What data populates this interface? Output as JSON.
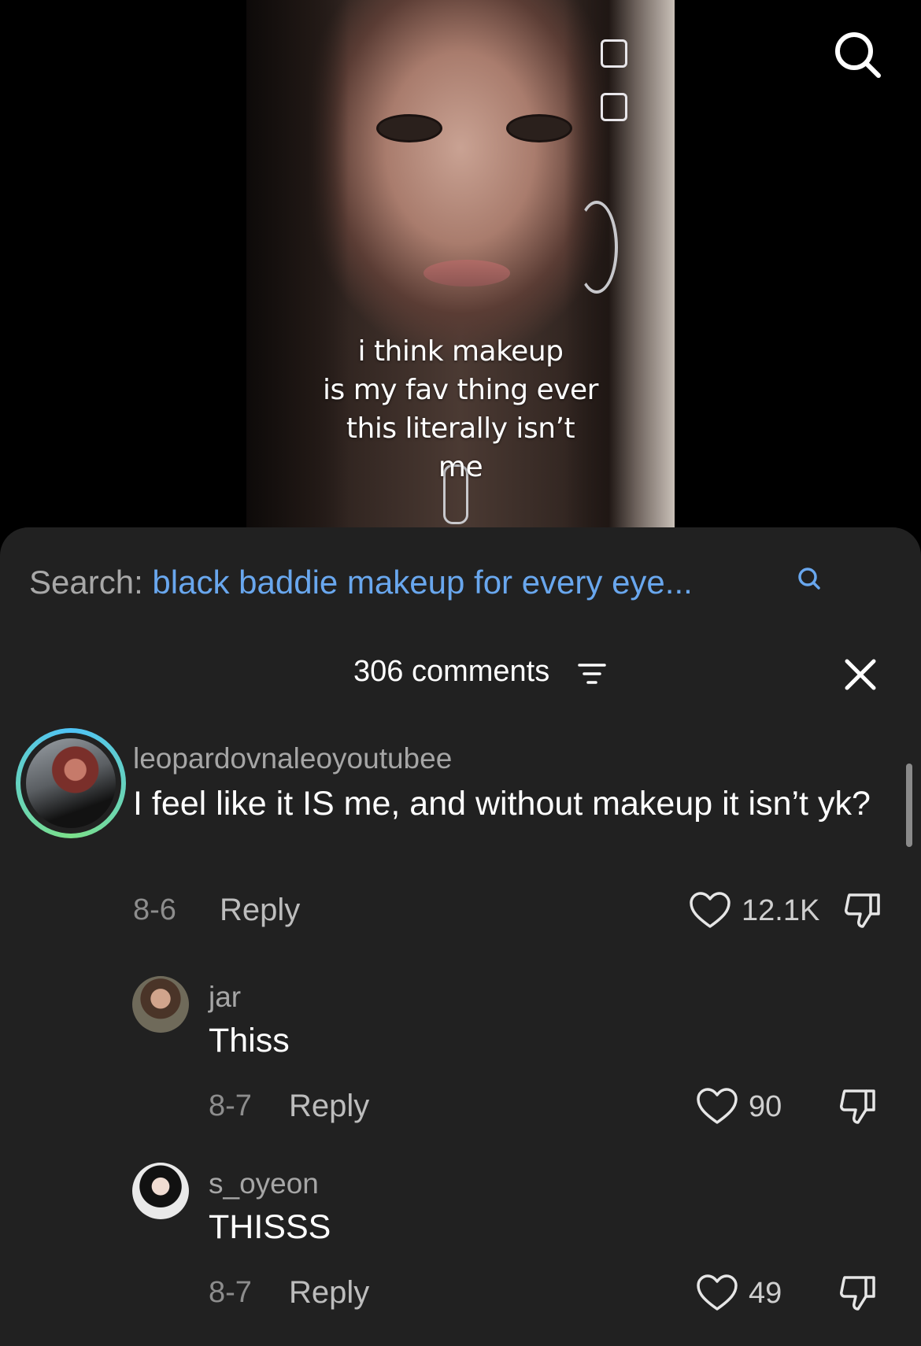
{
  "video": {
    "caption_lines": [
      "i think makeup",
      "is my fav thing ever",
      "this literally isn’t",
      "me"
    ]
  },
  "search": {
    "prefix": "Search:",
    "query": "black baddie makeup for every eye...",
    "icon": "search-icon"
  },
  "comments_header": {
    "count_label": "306 comments",
    "sort_icon": "sort-icon",
    "close_icon": "close-icon"
  },
  "comments": [
    {
      "username": "leopardovnaleoyoutubee",
      "text": "I feel like it IS me, and without makeup it isn’t yk?",
      "date": "8-6",
      "reply_label": "Reply",
      "likes": "12.1K",
      "has_story_ring": true
    },
    {
      "username": "jar",
      "text": "Thiss",
      "date": "8-7",
      "reply_label": "Reply",
      "likes": "90"
    },
    {
      "username": "s_oyeon",
      "text": "THISSS",
      "date": "8-7",
      "reply_label": "Reply",
      "likes": "49"
    }
  ],
  "colors": {
    "sheet_bg": "#212121",
    "search_query": "#69a7ee",
    "story_ring_start": "#4fc3f7",
    "story_ring_end": "#7be08a"
  }
}
